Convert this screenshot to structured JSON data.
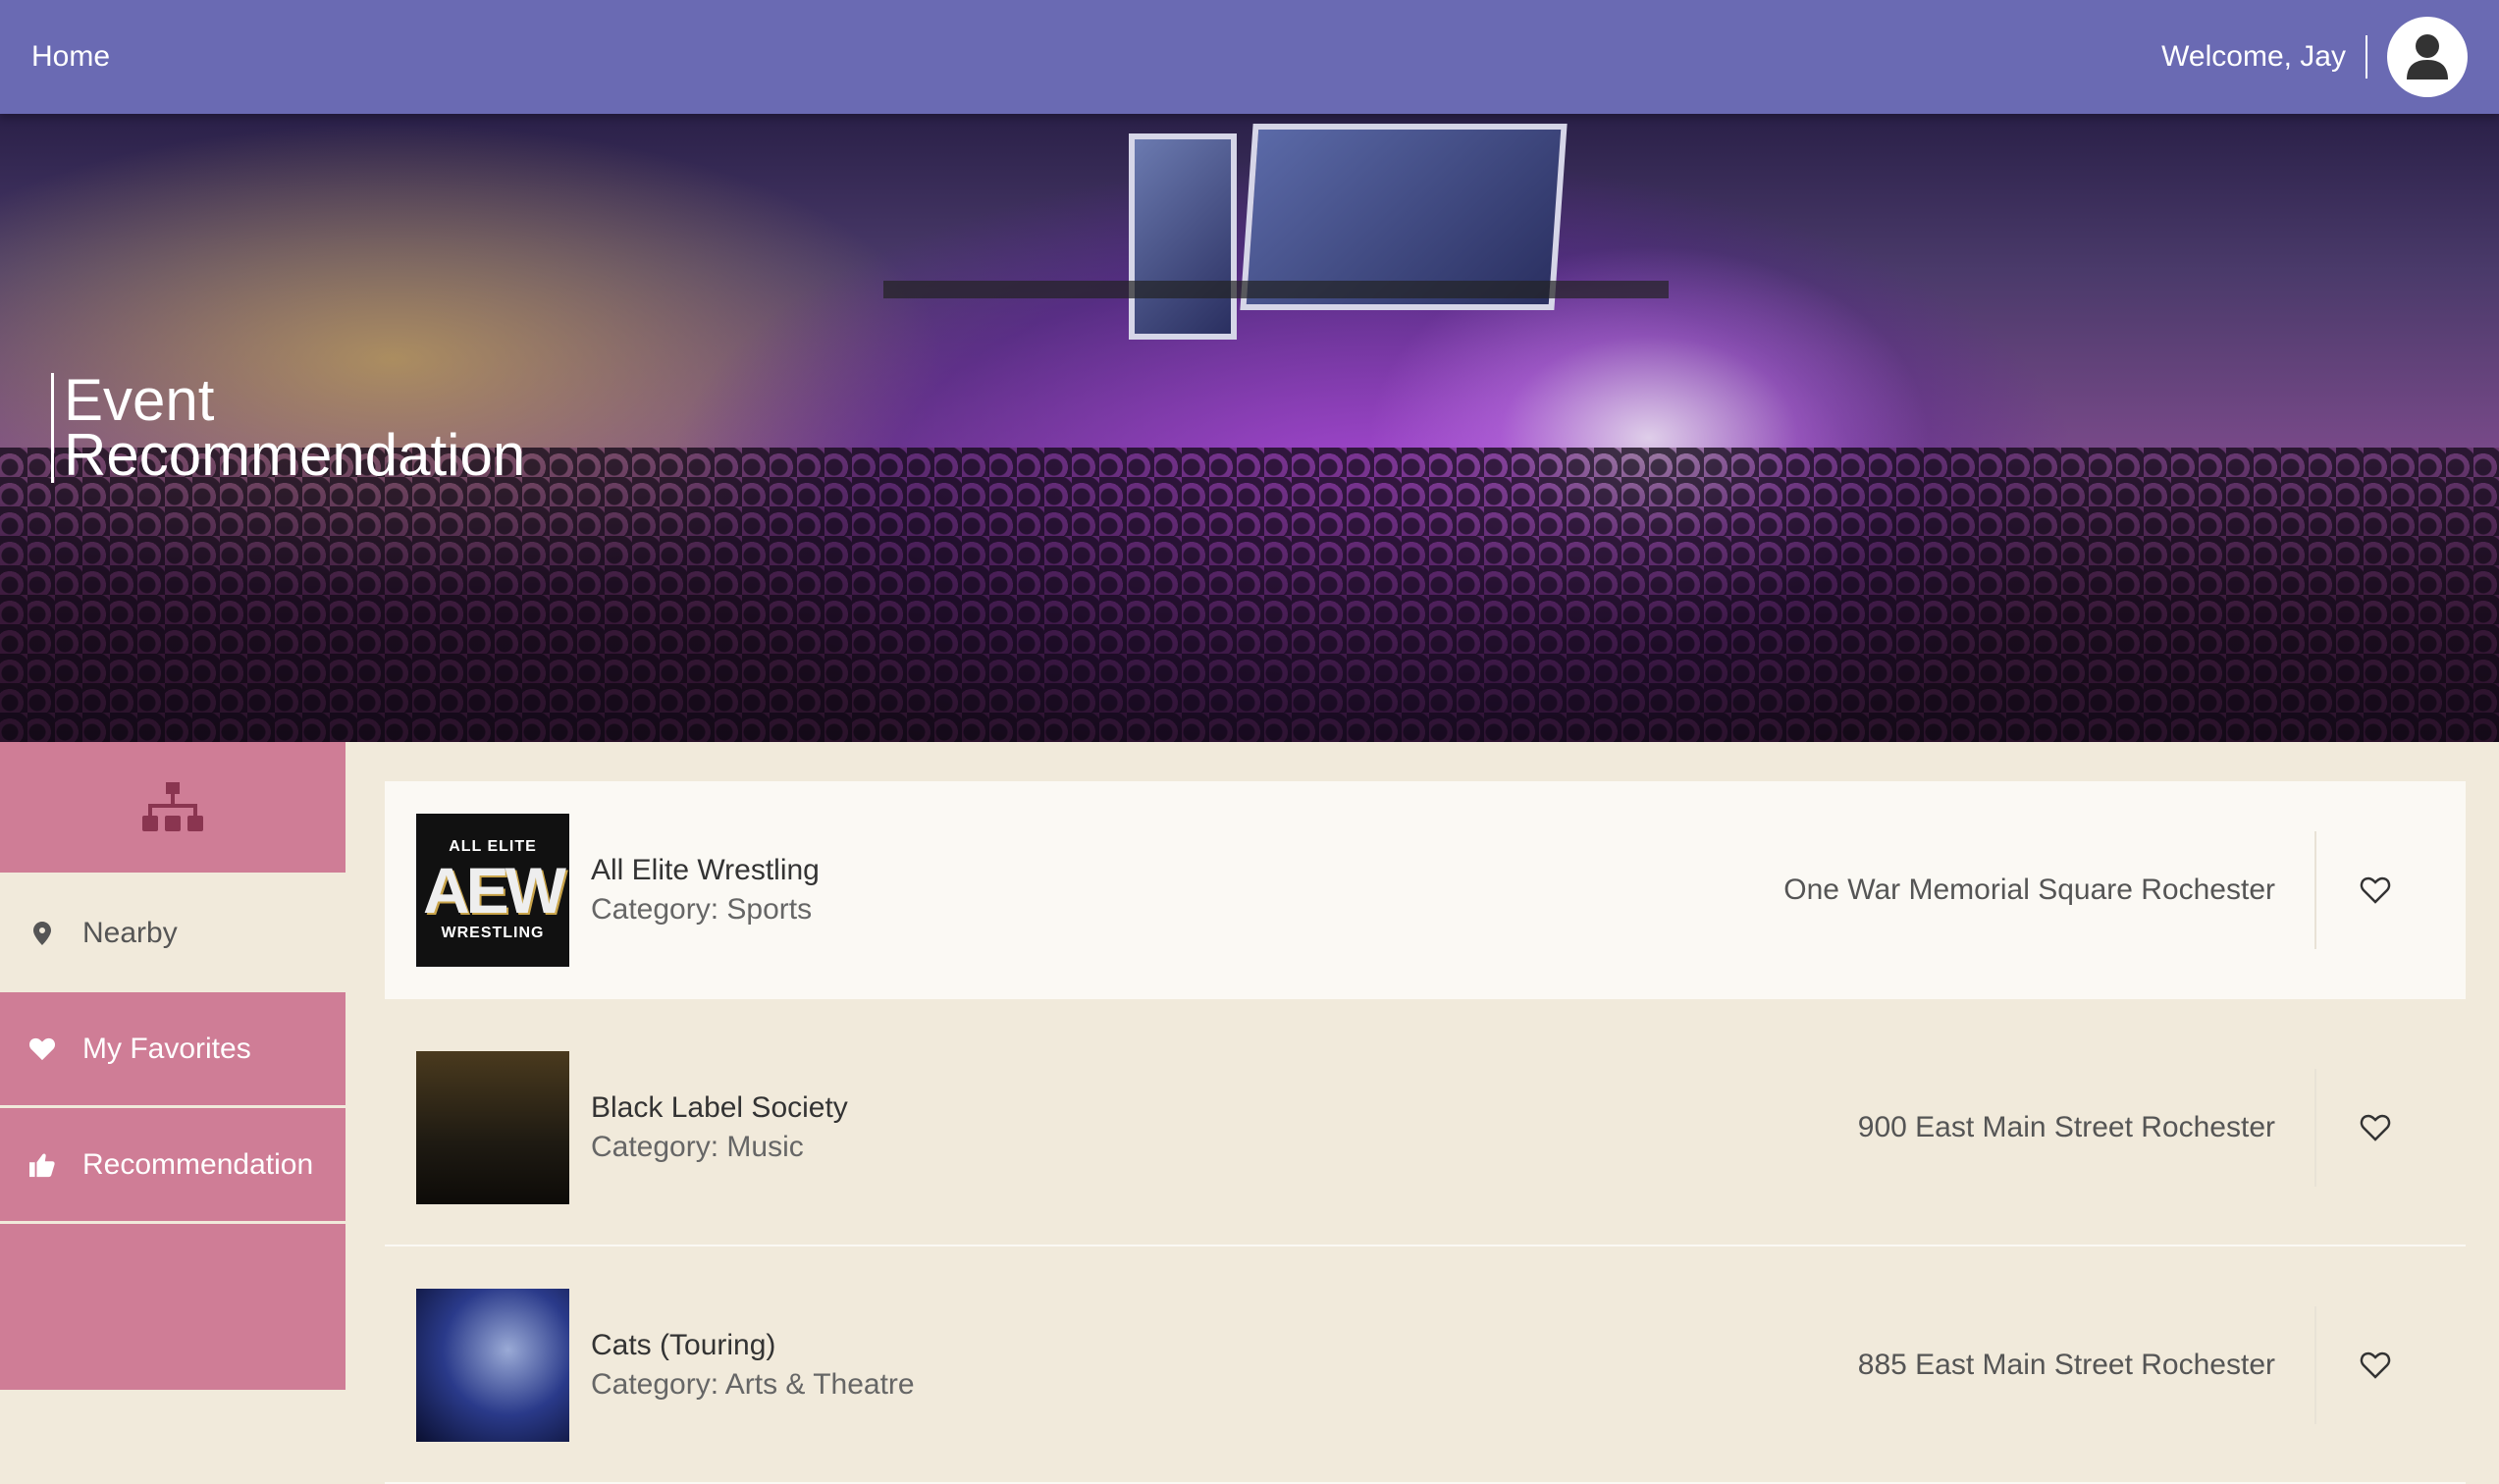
{
  "header": {
    "home_label": "Home",
    "welcome_text": "Welcome, Jay"
  },
  "hero": {
    "title_line1": "Event",
    "title_line2": "Recommendation"
  },
  "sidebar": {
    "items": [
      {
        "label": "Nearby",
        "icon": "map-pin-icon"
      },
      {
        "label": "My Favorites",
        "icon": "heart-icon"
      },
      {
        "label": "Recommendation",
        "icon": "thumbs-up-icon"
      }
    ]
  },
  "events": [
    {
      "name": "All Elite Wrestling",
      "category": "Category: Sports",
      "address": "One War Memorial Square Rochester",
      "thumb_top": "ALL ELITE",
      "thumb_mid": "AEW",
      "thumb_bottom": "WRESTLING"
    },
    {
      "name": "Black Label Society",
      "category": "Category: Music",
      "address": "900 East Main Street Rochester"
    },
    {
      "name": "Cats (Touring)",
      "category": "Category: Arts & Theatre",
      "address": "885 East Main Street Rochester"
    }
  ],
  "colors": {
    "topbar": "#6a6ab3",
    "sidebar": "#cf7d96",
    "background": "#f1eadb"
  }
}
